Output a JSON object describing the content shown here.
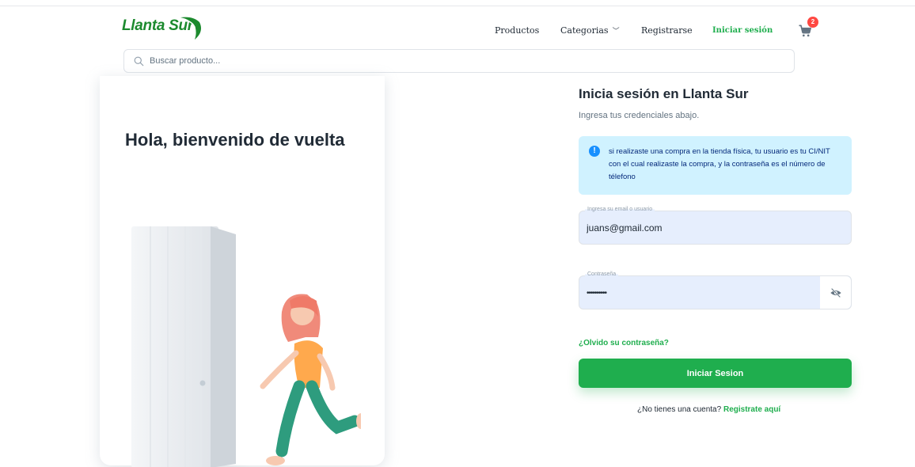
{
  "brand": {
    "logo_text": "Llanta Sur",
    "color": "#1c8a2e",
    "accent": "#1fae4e"
  },
  "nav": {
    "productos": "Productos",
    "categorias": "Categorias",
    "registrarse": "Registrarse",
    "iniciar_sesion": "Iniciar sesión",
    "cart_count": "2",
    "icons": {
      "chevron": "chevron-down-icon",
      "cart": "shopping-cart-icon"
    }
  },
  "search": {
    "placeholder": "Buscar producto...",
    "value": "",
    "icon": "search-icon"
  },
  "left_card": {
    "welcome": "Hola, bienvenido de vuelta"
  },
  "login": {
    "title": "Inicia sesión en Llanta Sur",
    "subtitle": "Ingresa tus credenciales abajo.",
    "info": "si realizaste una compra en la tienda física, tu usuario es tu CI/NIT con el cual realizaste la compra, y la contraseña es el número de télefono",
    "email_label": "Ingresa su email o usuario",
    "email_value": "juans@gmail.com",
    "password_label": "Contraseña",
    "password_value": "••••••••••",
    "forgot": "¿Olvido su contraseña?",
    "submit": "Iniciar Sesion",
    "no_account": "¿No tienes una cuenta?",
    "register_link": "Registrate aquí"
  }
}
